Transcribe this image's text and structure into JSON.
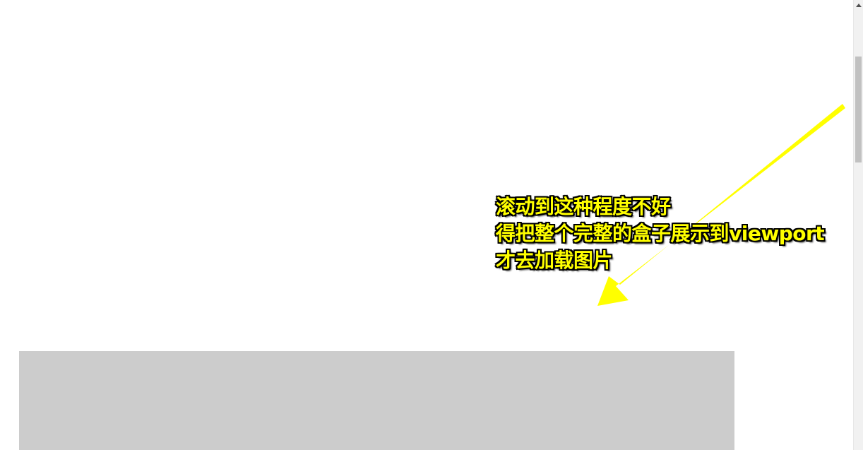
{
  "annotation": {
    "lines": [
      "滚动到这种程度不好",
      "得把整个完整的盒子展示到viewport",
      "才去加载图片"
    ],
    "text_color": "#ffff00",
    "outline_color": "#000000"
  },
  "arrow": {
    "color": "#ffff00",
    "icon": "arrow-icon"
  },
  "placeholder_box": {
    "color": "#cccccc"
  },
  "scrollbar": {
    "up_icon": "chevron-up-icon",
    "track_color": "#f1f1f1",
    "thumb_color": "#c1c1c1"
  }
}
